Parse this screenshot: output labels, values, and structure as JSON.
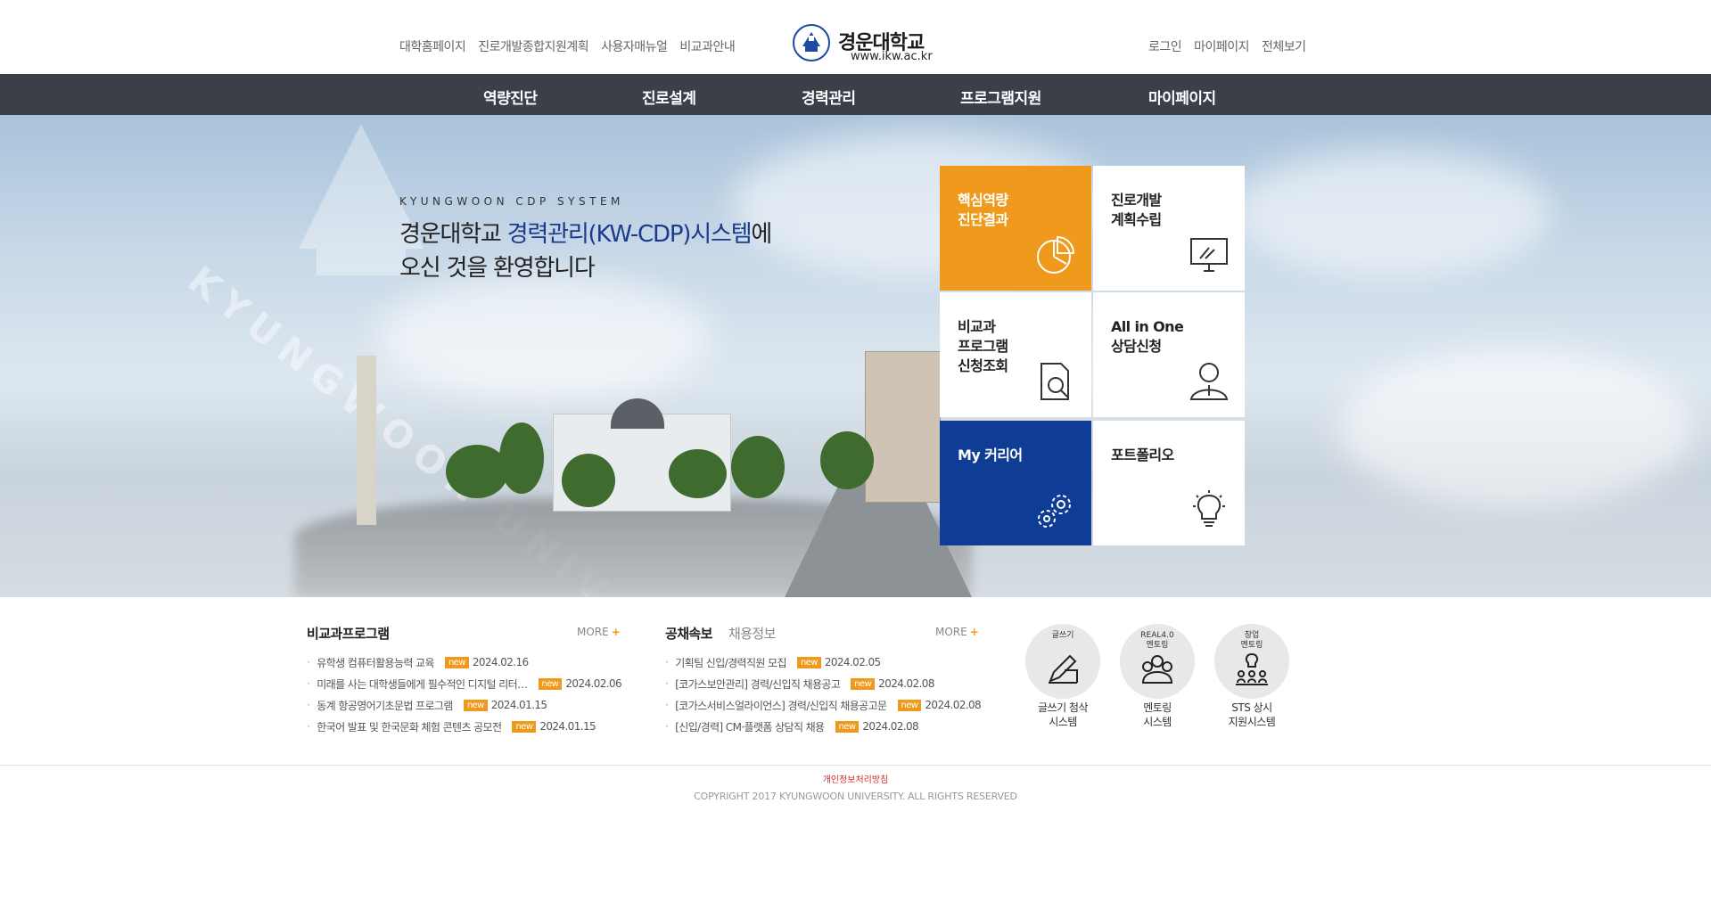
{
  "util_left": [
    "대학홈페이지",
    "진로개발종합지원계획",
    "사용자매뉴얼",
    "비교과안내"
  ],
  "util_right": [
    "로그인",
    "마이페이지",
    "전체보기"
  ],
  "logo": {
    "name": "경운대학교",
    "url": "www.ikw.ac.kr"
  },
  "gnb": [
    "역량진단",
    "진로설계",
    "경력관리",
    "프로그램지원",
    "마이페이지"
  ],
  "hero": {
    "eyebrow": "KYUNGWOON CDP SYSTEM",
    "title_pre": "경운대학교 ",
    "title_highlight": "경력관리(KW-CDP)시스템",
    "title_post": "에",
    "title_line2": "오신 것을 환영합니다",
    "watermark": "KYUNGWOON UNIV"
  },
  "tiles": [
    {
      "label": "핵심역량\n진단결과",
      "icon": "pie-chart-icon",
      "style": "orange"
    },
    {
      "label": "진로개발\n계획수립",
      "icon": "monitor-icon",
      "style": "white"
    },
    {
      "label": "비교과\n프로그램\n신청조회",
      "icon": "document-search-icon",
      "style": "white"
    },
    {
      "label": "All in One\n상담신청",
      "icon": "person-icon",
      "style": "white"
    },
    {
      "label": "My 커리어",
      "icon": "gears-icon",
      "style": "navy"
    },
    {
      "label": "포트폴리오",
      "icon": "lightbulb-icon",
      "style": "white"
    }
  ],
  "programs": {
    "title": "비교과프로그램",
    "more": "MORE",
    "items": [
      {
        "text": "유학생 컴퓨터활용능력 교육",
        "badge": "new",
        "date": "2024.02.16"
      },
      {
        "text": "미래를 사는 대학생들에게 필수적인 디지털 리터…",
        "badge": "new",
        "date": "2024.02.06"
      },
      {
        "text": "동계 항공영어기초문법 프로그램",
        "badge": "new",
        "date": "2024.01.15"
      },
      {
        "text": "한국어 발표 및 한국문화 체험 콘텐츠 공모전",
        "badge": "new",
        "date": "2024.01.15"
      }
    ]
  },
  "jobs": {
    "title": "공채속보",
    "subtitle": "채용정보",
    "more": "MORE",
    "items": [
      {
        "text": "기획팀 신입/경력직원 모집",
        "badge": "new",
        "date": "2024.02.05"
      },
      {
        "text": "[코가스보안관리] 경력/신입직 채용공고",
        "badge": "new",
        "date": "2024.02.08"
      },
      {
        "text": "[코가스서비스얼라이언스] 경력/신입직 채용공고문",
        "badge": "new",
        "date": "2024.02.08"
      },
      {
        "text": "[신입/경력] CM·플랫폼 상담직 채용",
        "badge": "new",
        "date": "2024.02.08"
      }
    ]
  },
  "systems": [
    {
      "top": "글쓰기",
      "label": "글쓰기 첨삭\n시스템",
      "icon": "pen-icon"
    },
    {
      "top": "REAL4.0\n멘토링",
      "label": "멘토링\n시스템",
      "icon": "mentoring-icon"
    },
    {
      "top": "창업\n멘토링",
      "label": "STS 상시\n지원시스템",
      "icon": "startup-icon"
    }
  ],
  "footer": {
    "privacy": "개인정보처리방침",
    "copyright": "COPYRIGHT 2017 KYUNGWOON UNIVERSITY. ALL RIGHTS RESERVED"
  },
  "colors": {
    "accent": "#ef9a1d",
    "navy": "#0f3d96",
    "gnb": "#3a3f48"
  }
}
